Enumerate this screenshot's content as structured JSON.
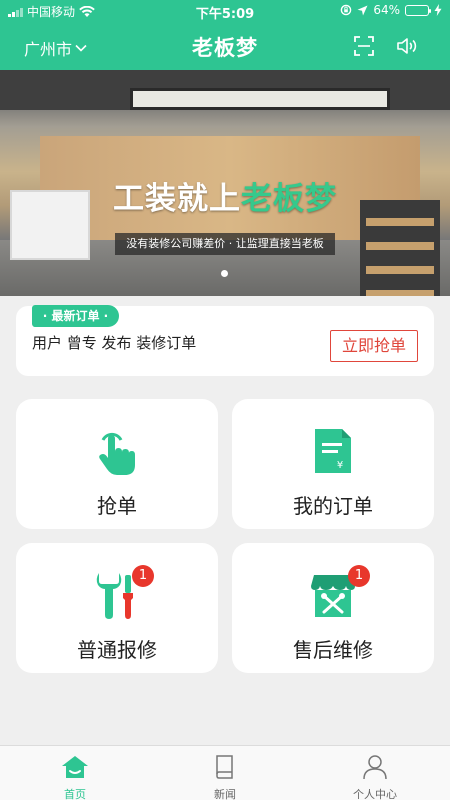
{
  "status_bar": {
    "carrier": "中国移动",
    "time": "下午5:09",
    "battery": "64%",
    "battery_level": 0.64
  },
  "header": {
    "city": "广州市",
    "title": "老板梦",
    "icons": [
      "scan-icon",
      "speaker-icon"
    ]
  },
  "banner": {
    "headline_main": "工装就上",
    "headline_accent": "老板梦",
    "subtitle": "没有装修公司赚差价 · 让监理直接当老板",
    "slide_count": 1,
    "active_slide": 1
  },
  "order_notice": {
    "badge": "· 最新订单 ·",
    "text": "用户 曾专 发布 装修订单",
    "button": "立即抢单"
  },
  "tiles": [
    {
      "label": "抢单",
      "icon": "tap-hand-icon",
      "badge": null
    },
    {
      "label": "我的订单",
      "icon": "order-document-icon",
      "badge": null
    },
    {
      "label": "普通报修",
      "icon": "wrench-screwdriver-icon",
      "badge": "1"
    },
    {
      "label": "售后维修",
      "icon": "repair-shop-icon",
      "badge": "1"
    }
  ],
  "tabbar": [
    {
      "label": "首页",
      "icon": "home-icon",
      "active": true
    },
    {
      "label": "新闻",
      "icon": "book-icon",
      "active": false
    },
    {
      "label": "个人中心",
      "icon": "user-icon",
      "active": false
    }
  ],
  "colors": {
    "brand": "#2ec592",
    "alert": "#e0463b",
    "badge": "#e8372c"
  }
}
